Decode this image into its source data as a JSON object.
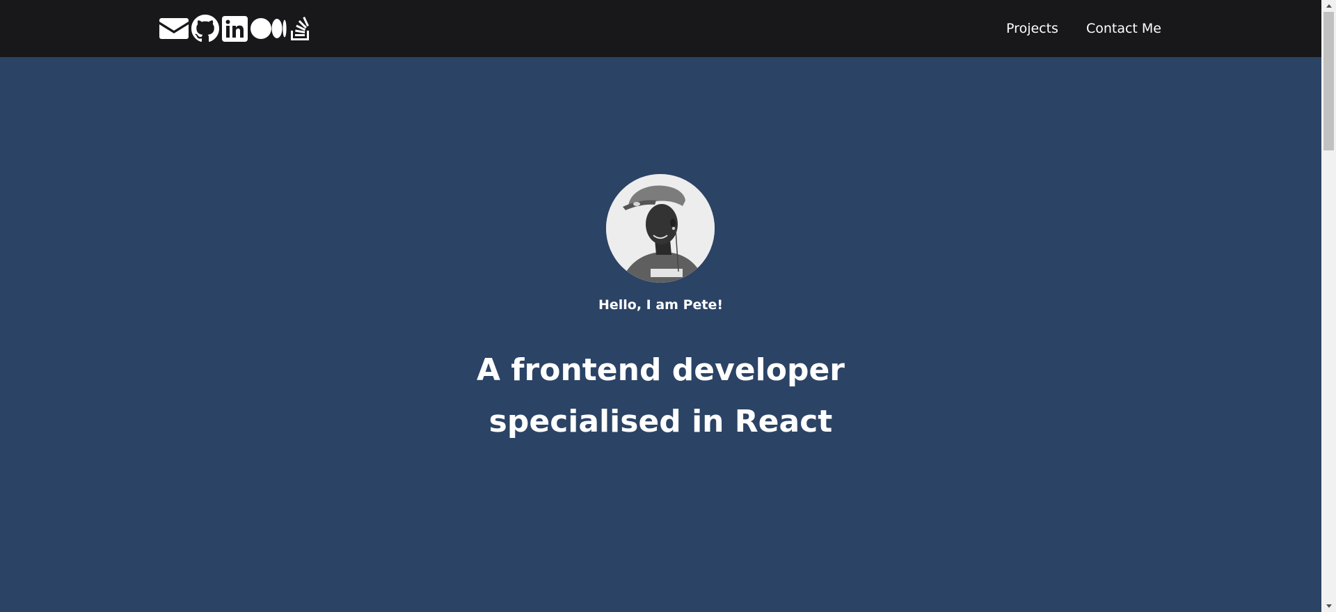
{
  "header": {
    "social_icons": [
      "envelope-icon",
      "github-icon",
      "linkedin-icon",
      "medium-icon",
      "stackoverflow-icon"
    ],
    "nav": {
      "projects_label": "Projects",
      "contact_label": "Contact Me"
    }
  },
  "hero": {
    "greeting": "Hello, I am Pete!",
    "headline_line1": "A frontend developer",
    "headline_line2": "specialised in React"
  },
  "colors": {
    "header_bg": "#18181b",
    "hero_bg": "#2b4365",
    "text": "#ffffff"
  }
}
